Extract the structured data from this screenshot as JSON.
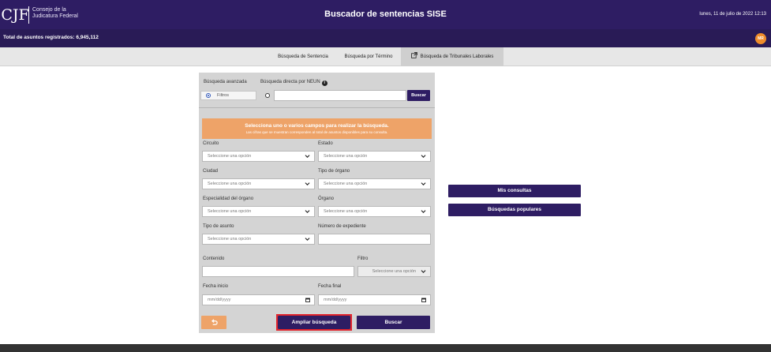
{
  "header": {
    "logo_text": "CJF",
    "org_line1": "Consejo de la",
    "org_line2": "Judicatura Federal",
    "title": "Buscador de sentencias SISE",
    "date": "lunes, 11 de julio de 2022 12:13"
  },
  "subheader": {
    "total": "Total de asuntos registrados: 6,945,112",
    "avatar_initials": "MR"
  },
  "nav": {
    "tabs": [
      {
        "label": "Búsqueda de Sentencia"
      },
      {
        "label": "Búsqueda por Término"
      },
      {
        "label": "Búsqueda de Tribunales Laborales",
        "icon": "external-link-icon",
        "active": true
      }
    ]
  },
  "search_mode": {
    "advanced_label": "Búsqueda avanzada",
    "direct_label": "Búsqueda directa por NEUN",
    "filters_option": "Filtros",
    "direct_value": "",
    "search_button": "Buscar"
  },
  "notice": {
    "title": "Selecciona uno o varios campos para realizar la búsqueda.",
    "subtitle": "Las cifras que se muestran corresponden al total de asuntos disponibles para su consulta."
  },
  "fields": {
    "circuito": {
      "label": "Circuito",
      "value": "Seleccione una opción"
    },
    "estado": {
      "label": "Estado",
      "value": "Seleccione una opción"
    },
    "ciudad": {
      "label": "Ciudad",
      "value": "Seleccione una opción"
    },
    "tipo_organo": {
      "label": "Tipo de órgano",
      "value": "Seleccione una opción"
    },
    "especialidad": {
      "label": "Especialidad del órgano",
      "value": "Seleccione una opción"
    },
    "organo": {
      "label": "Órgano",
      "value": "Seleccione una opción"
    },
    "tipo_asunto": {
      "label": "Tipo de asunto",
      "value": "Seleccione una opción"
    },
    "expediente": {
      "label": "Número de expediente",
      "value": ""
    },
    "contenido": {
      "label": "Contenido",
      "value": ""
    },
    "filtro": {
      "label": "Filtro",
      "value": "Seleccione una opción"
    },
    "fecha_inicio": {
      "label": "Fecha inicio",
      "placeholder": "mm/dd/yyyy"
    },
    "fecha_final": {
      "label": "Fecha final",
      "placeholder": "mm/dd/yyyy"
    }
  },
  "actions": {
    "reset_icon": "undo-icon",
    "expand": "Ampliar búsqueda",
    "search": "Buscar"
  },
  "side": {
    "my_queries": "Mis consultas",
    "popular": "Búsquedas populares"
  },
  "colors": {
    "primary": "#2e1d63",
    "accent_orange": "#eea368",
    "highlight": "#e3242b"
  }
}
